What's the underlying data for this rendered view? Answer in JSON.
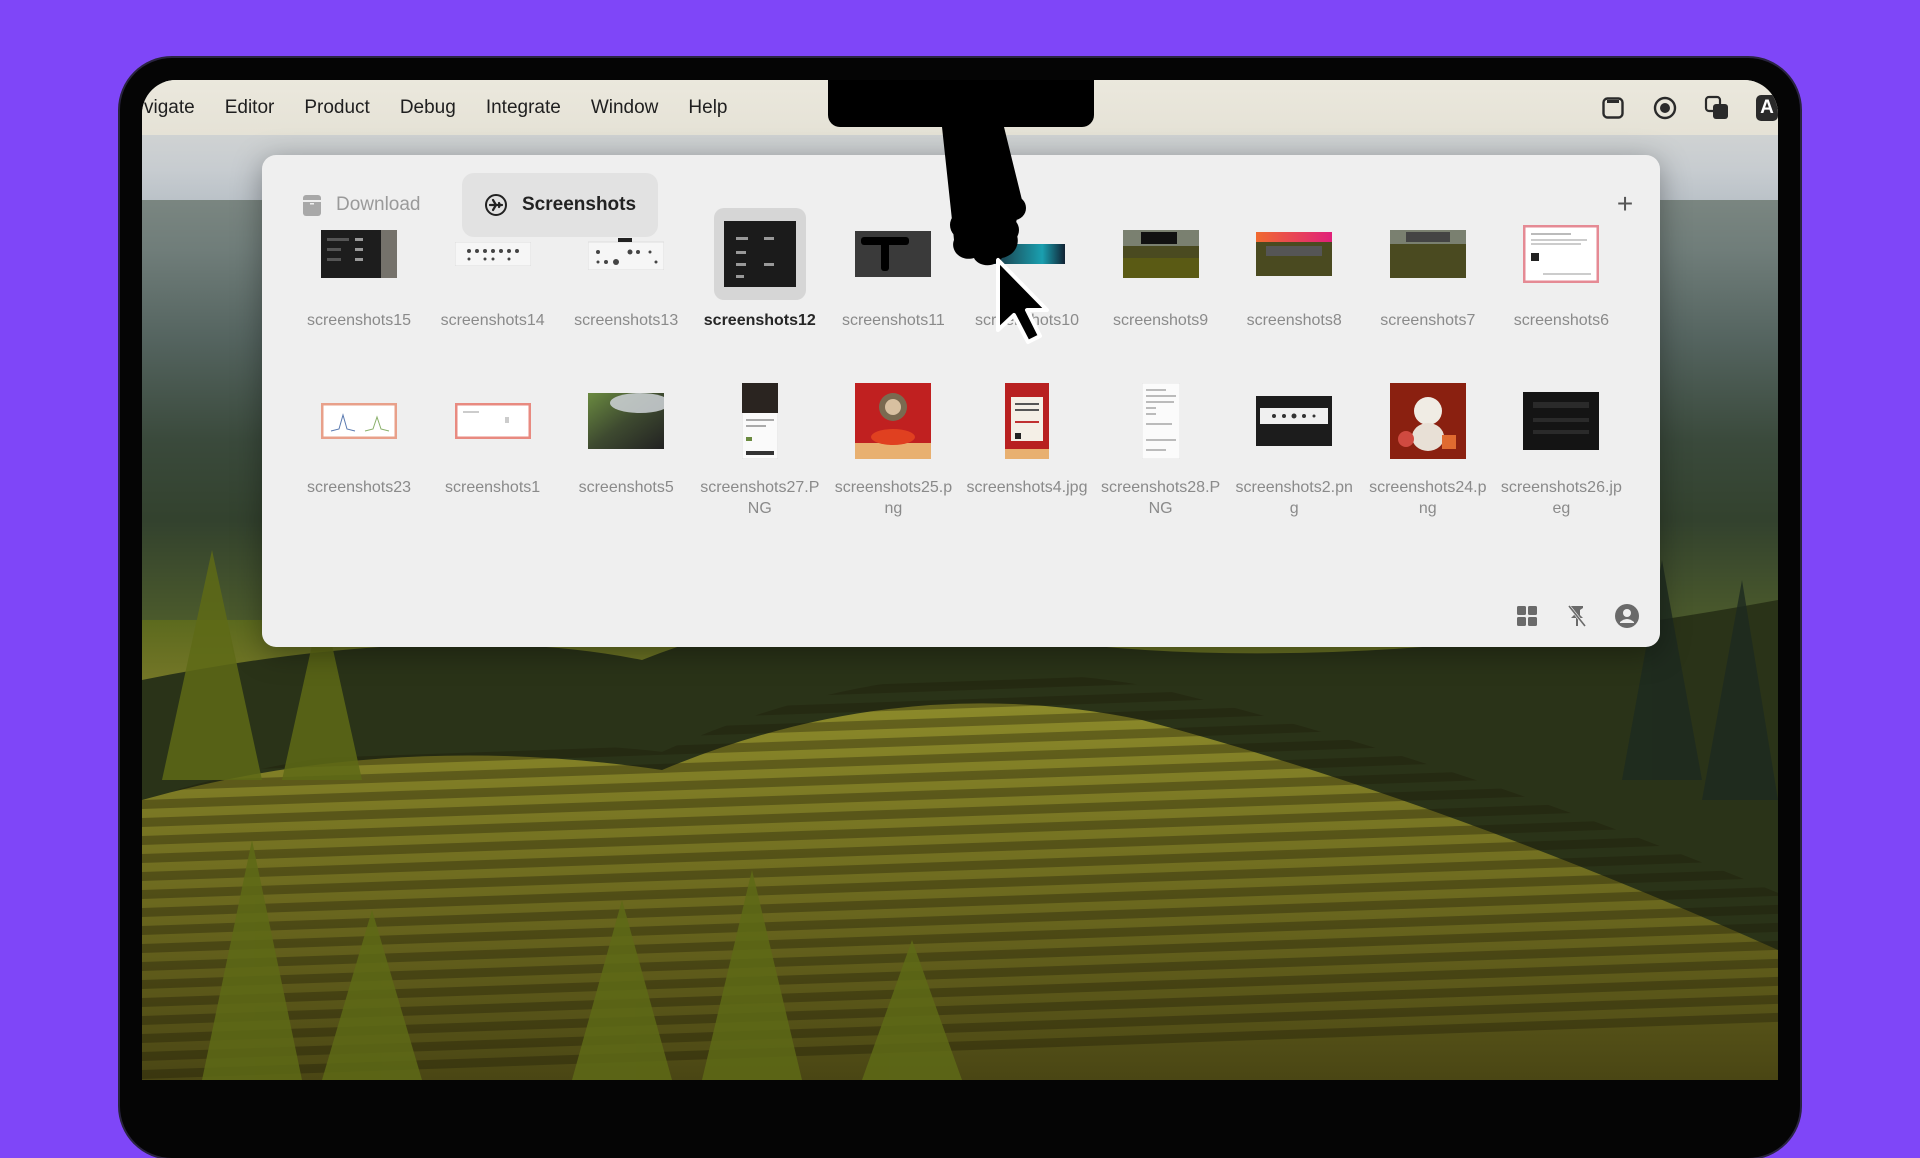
{
  "menubar": {
    "items": [
      "vigate",
      "Editor",
      "Product",
      "Debug",
      "Integrate",
      "Window",
      "Help"
    ],
    "right_icons": [
      "window-icon",
      "record-icon",
      "overlapping-squares-icon",
      "input-source-icon"
    ],
    "input_source_label": "A"
  },
  "panel": {
    "tabs": [
      {
        "label": "Download",
        "icon": "archive-box-icon",
        "active": false
      },
      {
        "label": "Screenshots",
        "icon": "airplane-circle-icon",
        "active": true
      }
    ],
    "add_label": "+",
    "files": [
      {
        "name": "screenshots15",
        "thumb": "dark-ui"
      },
      {
        "name": "screenshots14",
        "thumb": "light-toolbar"
      },
      {
        "name": "screenshots13",
        "thumb": "light-toolbar-2"
      },
      {
        "name": "screenshots12",
        "thumb": "dark-ui-tall",
        "selected": true
      },
      {
        "name": "screenshots11",
        "thumb": "dark-notch"
      },
      {
        "name": "screenshots10",
        "thumb": "teal-bar"
      },
      {
        "name": "screenshots9",
        "thumb": "landscape-dark-menu"
      },
      {
        "name": "screenshots8",
        "thumb": "landscape-gradient-bar"
      },
      {
        "name": "screenshots7",
        "thumb": "landscape-menu"
      },
      {
        "name": "screenshots6",
        "thumb": "pink-document"
      },
      {
        "name": "screenshots23",
        "thumb": "chart-pink-border"
      },
      {
        "name": "screenshots1",
        "thumb": "blank-pink-border"
      },
      {
        "name": "screenshots5",
        "thumb": "cloud-landscape"
      },
      {
        "name": "screenshots27.PNG",
        "thumb": "phone-screenshot"
      },
      {
        "name": "screenshots25.png",
        "thumb": "red-dragon"
      },
      {
        "name": "screenshots4.jpg",
        "thumb": "red-poster"
      },
      {
        "name": "screenshots28.PNG",
        "thumb": "white-phone-doc"
      },
      {
        "name": "screenshots2.png",
        "thumb": "dark-toolbar"
      },
      {
        "name": "screenshots24.png",
        "thumb": "white-dragon"
      },
      {
        "name": "screenshots26.jpeg",
        "thumb": "dark-screen"
      }
    ],
    "footer_icons": [
      "grid-view-icon",
      "unpin-icon",
      "account-icon"
    ]
  },
  "colors": {
    "background": "#7f46f8",
    "panel": "#efefef",
    "menubar": "#e8e5da",
    "selected_tab": "#e2e2e2"
  }
}
